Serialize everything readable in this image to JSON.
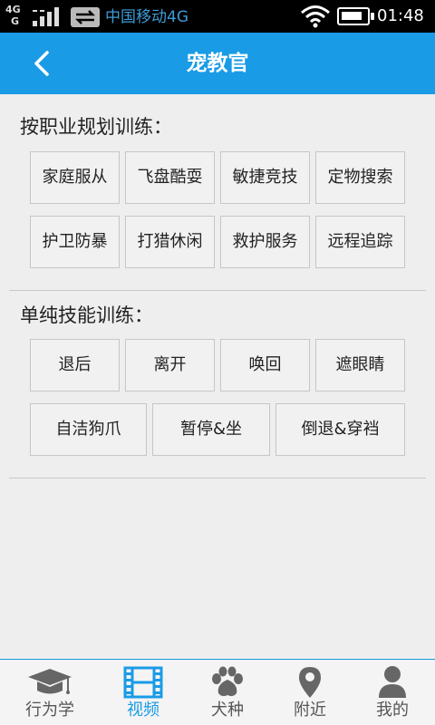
{
  "status": {
    "network_type": "4G",
    "network_sub": "G",
    "carrier": "中国移动4G",
    "time": "01:48"
  },
  "header": {
    "title": "宠教官"
  },
  "sections": [
    {
      "title": "按职业规划训练：",
      "buttons": [
        "家庭服从",
        "飞盘酷耍",
        "敏捷竞技",
        "定物搜索",
        "护卫防暴",
        "打猎休闲",
        "救护服务",
        "远程追踪"
      ]
    },
    {
      "title": "单纯技能训练：",
      "buttons": [
        "退后",
        "离开",
        "唤回",
        "遮眼睛",
        "自洁狗爪",
        "暂停&坐",
        "倒退&穿裆"
      ]
    }
  ],
  "tabs": [
    {
      "label": "行为学",
      "icon": "graduation-cap-icon",
      "active": false
    },
    {
      "label": "视频",
      "icon": "film-icon",
      "active": true
    },
    {
      "label": "犬种",
      "icon": "paw-icon",
      "active": false
    },
    {
      "label": "附近",
      "icon": "location-pin-icon",
      "active": false
    },
    {
      "label": "我的",
      "icon": "user-icon",
      "active": false
    }
  ],
  "colors": {
    "accent": "#1a9be6",
    "background": "#eeeeee",
    "tab_inactive": "#555555"
  }
}
